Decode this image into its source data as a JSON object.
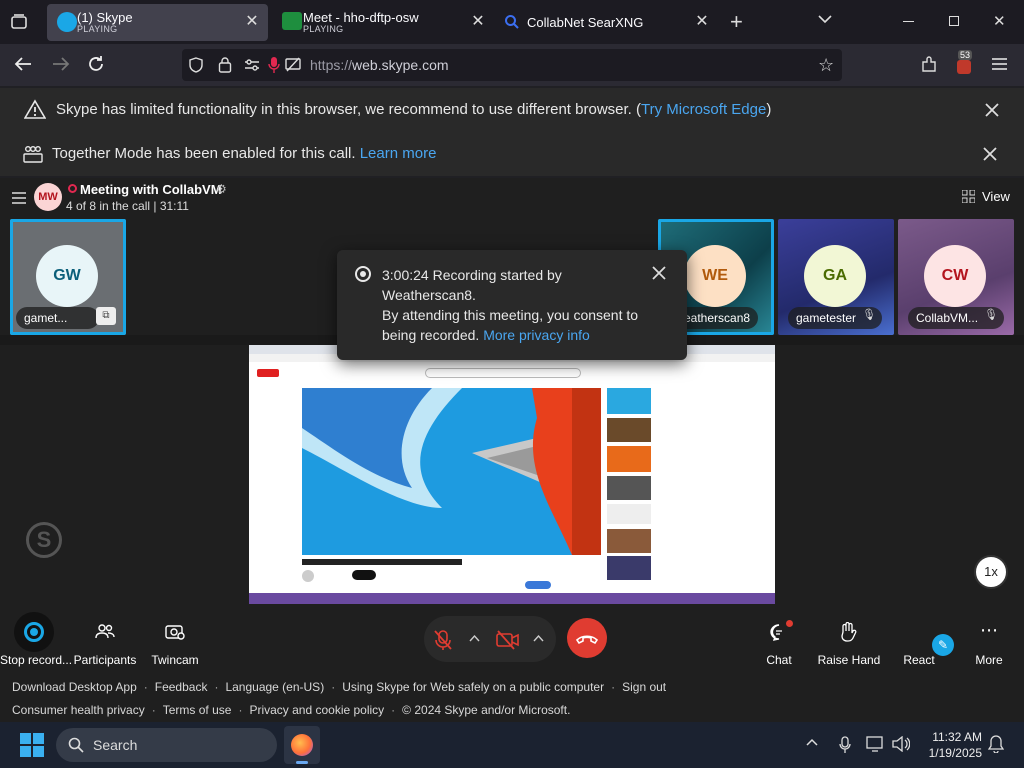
{
  "browser": {
    "tabs": [
      {
        "title": "(1) Skype",
        "status": "PLAYING"
      },
      {
        "title": "Meet - hho-dftp-osw",
        "status": "PLAYING"
      },
      {
        "title": "CollabNet SearXNG",
        "status": ""
      }
    ],
    "url_prefix": "https://",
    "url_host": "web.skype.com",
    "extensions_badge": "53"
  },
  "banners": {
    "browser_warning": {
      "text": "Skype has limited functionality in this browser, we recommend to use different browser. (",
      "link": "Try Microsoft Edge",
      "suffix": ")"
    },
    "together_mode": {
      "text": "Together Mode has been enabled for this call.",
      "link": "Learn more"
    }
  },
  "call": {
    "avatar_initials": "MW",
    "title": "Meeting with CollabVM",
    "subtitle": "4 of 8 in the call | 31:11",
    "view_label": "View"
  },
  "participants": [
    {
      "initials": "GW",
      "name": "gamet...",
      "color": "#0b5f7a",
      "avatar_bg": "#e8f5f8"
    },
    {
      "initials": "WE",
      "name": "eatherscan8",
      "color": "#b15a0c",
      "avatar_bg": "#fde0c4"
    },
    {
      "initials": "GA",
      "name": "gametester",
      "color": "#4a6b00",
      "avatar_bg": "#f2f7d5"
    },
    {
      "initials": "CW",
      "name": "CollabVM...",
      "color": "#b3141e",
      "avatar_bg": "#fde4e4"
    }
  ],
  "recording_popup": {
    "line1": "3:00:24 Recording started by",
    "line2": "Weatherscan8.",
    "line3": "By attending this meeting, you consent to",
    "line4": "being recorded.",
    "link": "More privacy info"
  },
  "playback_speed": "1x",
  "toolbar": {
    "stop_recording": "Stop record...",
    "participants": "Participants",
    "twincam": "Twincam",
    "chat": "Chat",
    "raise_hand": "Raise Hand",
    "react": "React",
    "more": "More"
  },
  "footer": {
    "row1": [
      "Download Desktop App",
      "Feedback",
      "Language (en-US)",
      "Using Skype for Web safely on a public computer",
      "Sign out"
    ],
    "row2": [
      "Consumer health privacy",
      "Terms of use",
      "Privacy and cookie policy",
      "© 2024 Skype and/or Microsoft."
    ]
  },
  "taskbar": {
    "search_label": "Search",
    "time": "11:32 AM",
    "date": "1/19/2025"
  },
  "colors": {
    "accent": "#1aa7e6",
    "hangup": "#e03c31",
    "link": "#4aa6f0"
  }
}
